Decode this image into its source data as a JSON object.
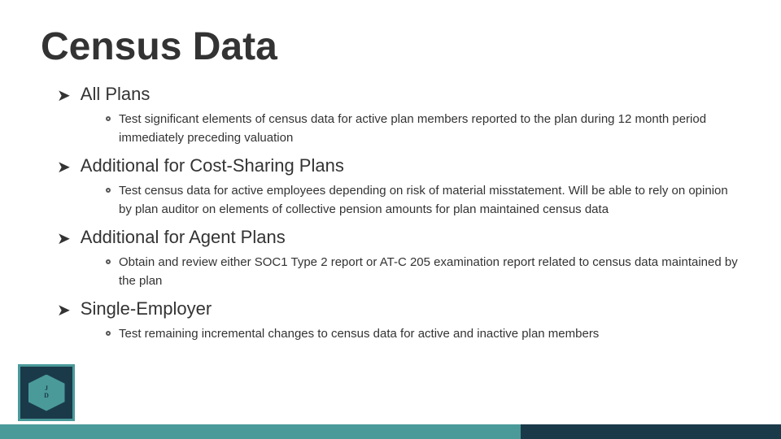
{
  "slide": {
    "title": "Census Data",
    "sections": [
      {
        "id": "all-plans",
        "level": 1,
        "label": "All Plans",
        "subitems": [
          {
            "id": "all-plans-sub1",
            "text": "Test significant elements of census data for active plan members reported to the plan during 12 month period immediately preceding valuation"
          }
        ]
      },
      {
        "id": "additional-cost-sharing",
        "level": 1,
        "label": "Additional for Cost-Sharing Plans",
        "subitems": [
          {
            "id": "cost-sharing-sub1",
            "text": "Test census data for active employees depending on risk of material misstatement. Will be able to rely on opinion by plan auditor on elements of collective pension amounts for plan maintained census data"
          }
        ]
      },
      {
        "id": "additional-agent",
        "level": 1,
        "label": "Additional for Agent Plans",
        "subitems": [
          {
            "id": "agent-sub1",
            "text": "Obtain and review either SOC1 Type 2 report or AT-C 205 examination report related to census data maintained by the plan"
          }
        ]
      },
      {
        "id": "single-employer",
        "level": 1,
        "label": "Single-Employer",
        "subitems": [
          {
            "id": "single-employer-sub1",
            "text": "Test remaining incremental changes to census data for active and inactive plan members"
          }
        ]
      }
    ]
  },
  "logo": {
    "alt": "Company logo"
  }
}
